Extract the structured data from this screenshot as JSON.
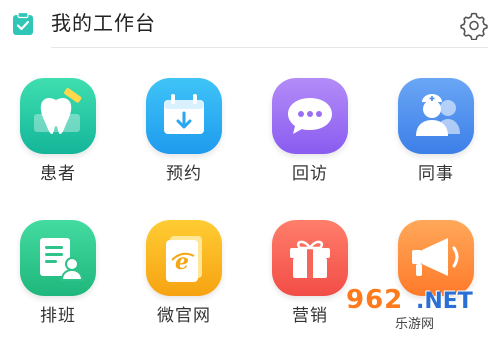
{
  "header": {
    "title": "我的工作台",
    "icon": "clipboard-check-icon",
    "settings_icon": "gear-icon"
  },
  "tiles": [
    {
      "label": "患者",
      "icon": "tooth-icon",
      "color_from": "#3fdfb0",
      "color_to": "#14b59a"
    },
    {
      "label": "预约",
      "icon": "calendar-icon",
      "color_from": "#3fc4f7",
      "color_to": "#1e9bee"
    },
    {
      "label": "回访",
      "icon": "chat-bubble-icon",
      "color_from": "#b38cf8",
      "color_to": "#8a5cf0"
    },
    {
      "label": "同事",
      "icon": "colleagues-icon",
      "color_from": "#6aa6f5",
      "color_to": "#3c7fe8"
    },
    {
      "label": "排班",
      "icon": "schedule-person-icon",
      "color_from": "#44dba0",
      "color_to": "#1fb77c"
    },
    {
      "label": "微官网",
      "icon": "browser-e-icon",
      "color_from": "#ffcc33",
      "color_to": "#f6a312"
    },
    {
      "label": "营销",
      "icon": "gift-icon",
      "color_from": "#ff7e6a",
      "color_to": "#f24d47"
    },
    {
      "label": "",
      "icon": "megaphone-icon",
      "color_from": "#ffa85a",
      "color_to": "#ff7a2a"
    }
  ],
  "watermark": {
    "number": "962",
    "suffix": ".NET",
    "text": "乐游网"
  }
}
